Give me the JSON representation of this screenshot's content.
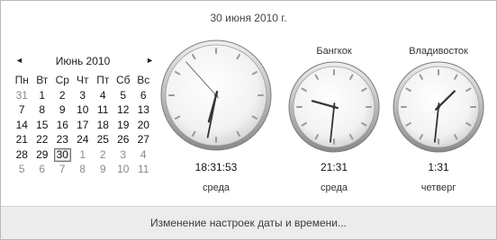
{
  "header": {
    "date": "30 июня 2010 г."
  },
  "calendar": {
    "month_title": "Июнь 2010",
    "prev_glyph": "◄",
    "next_glyph": "►",
    "weekdays": [
      "Пн",
      "Вт",
      "Ср",
      "Чт",
      "Пт",
      "Сб",
      "Вс"
    ],
    "weeks": [
      [
        "31",
        "1",
        "2",
        "3",
        "4",
        "5",
        "6"
      ],
      [
        "7",
        "8",
        "9",
        "10",
        "11",
        "12",
        "13"
      ],
      [
        "14",
        "15",
        "16",
        "17",
        "18",
        "19",
        "20"
      ],
      [
        "21",
        "22",
        "23",
        "24",
        "25",
        "26",
        "27"
      ],
      [
        "28",
        "29",
        "30",
        "1",
        "2",
        "3",
        "4"
      ],
      [
        "5",
        "6",
        "7",
        "8",
        "9",
        "10",
        "11"
      ]
    ],
    "today": "30"
  },
  "clocks": [
    {
      "label": "",
      "time": "18:31:53",
      "day": "среда",
      "hour": 18,
      "minute": 31,
      "second": 53,
      "show_seconds": true
    },
    {
      "label": "Бангкок",
      "time": "21:31",
      "day": "среда",
      "hour": 21,
      "minute": 31,
      "second": 0,
      "show_seconds": false
    },
    {
      "label": "Владивосток",
      "time": "1:31",
      "day": "четверг",
      "hour": 1,
      "minute": 31,
      "second": 0,
      "show_seconds": false
    }
  ],
  "footer": {
    "link": "Изменение настроек даты и времени..."
  }
}
